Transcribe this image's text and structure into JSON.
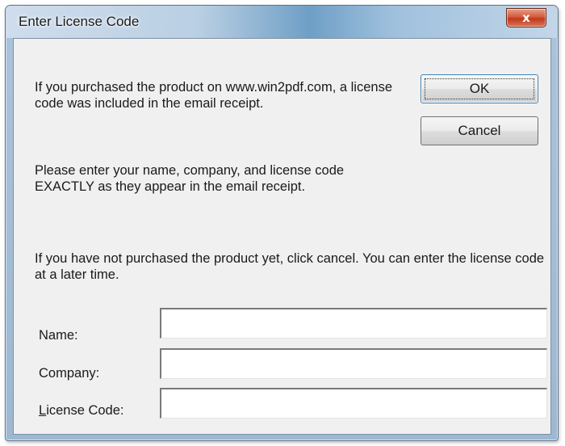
{
  "window": {
    "title": "Enter License Code",
    "close_label": "x"
  },
  "message": {
    "para1": "If you purchased the product on www.win2pdf.com, a license code was included in the email receipt.",
    "para2": "Please enter your name, company, and license code EXACTLY as they appear in the email receipt.",
    "para3": "If you have not purchased the product yet, click cancel. You can enter the license code at a later time."
  },
  "buttons": {
    "ok_label": "OK",
    "cancel_label": "Cancel"
  },
  "fields": {
    "name_label": "Name:",
    "name_value": "",
    "company_label": "Company:",
    "company_value": "",
    "license_label_first": "L",
    "license_label_rest": "icense Code:",
    "license_value": ""
  },
  "colors": {
    "titlebar": "#b9cfe3",
    "close_button": "#c2381c",
    "dialog_bg": "#f0f0f0"
  }
}
